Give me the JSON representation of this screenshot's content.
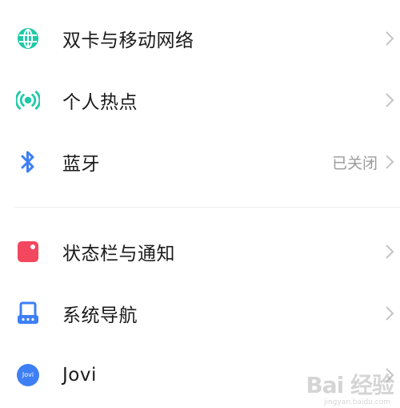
{
  "settings": {
    "items": [
      {
        "label": "双卡与移动网络",
        "icon": "globe-icon",
        "value": ""
      },
      {
        "label": "个人热点",
        "icon": "hotspot-icon",
        "value": ""
      },
      {
        "label": "蓝牙",
        "icon": "bluetooth-icon",
        "value": "已关闭"
      },
      {
        "label": "状态栏与通知",
        "icon": "status-bar-icon",
        "value": ""
      },
      {
        "label": "系统导航",
        "icon": "navigation-icon",
        "value": ""
      },
      {
        "label": "Jovi",
        "icon": "jovi-icon",
        "icon_text": "Jovi",
        "value": ""
      }
    ]
  },
  "watermark": {
    "main": "Bai 经验",
    "sub": "jingyan.baidu.com"
  },
  "colors": {
    "teal": "#1fc9a8",
    "blue": "#3e7ff5",
    "red": "#f2475e",
    "text": "#1a1a1a",
    "secondary_text": "#9a9a9a",
    "chevron": "#c4c4c4"
  }
}
